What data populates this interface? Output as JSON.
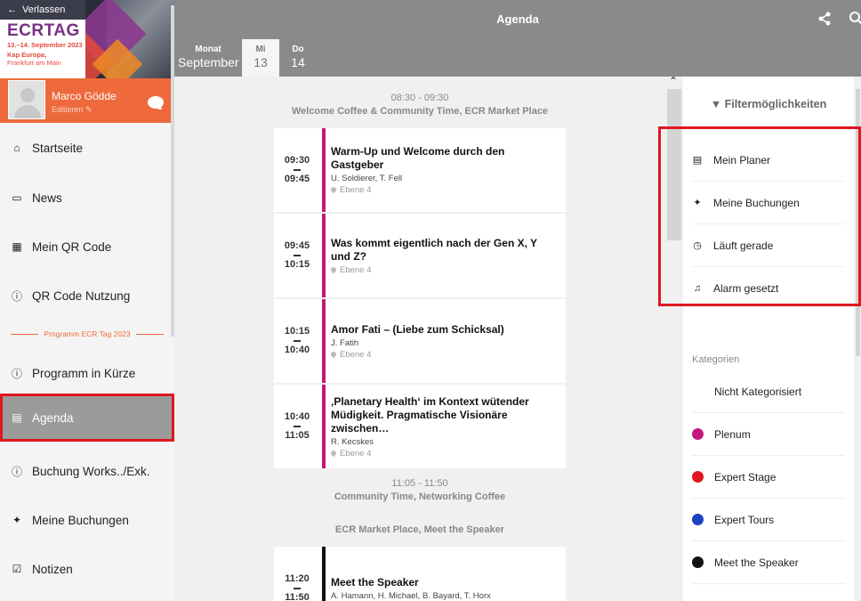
{
  "sidebar": {
    "back_label": "Verlassen",
    "event": {
      "title": "ECRTAG",
      "date": "13.–14. September 2023",
      "place1": "Kap Europa,",
      "place2": "Frankfurt am Main"
    },
    "user": {
      "name": "Marco Gödde",
      "edit": "Editieren"
    },
    "items": [
      {
        "label": "Startseite",
        "icon": "home-icon"
      },
      {
        "label": "News",
        "icon": "inbox-icon"
      },
      {
        "label": "Mein QR Code",
        "icon": "qr-icon"
      },
      {
        "label": "QR Code Nutzung",
        "icon": "info-icon"
      },
      {
        "label": "Programm in Kürze",
        "icon": "info-icon"
      },
      {
        "label": "Agenda",
        "icon": "calendar-icon"
      },
      {
        "label": "Buchung Works../Exk.",
        "icon": "info-icon"
      },
      {
        "label": "Meine Buchungen",
        "icon": "ticket-icon"
      },
      {
        "label": "Notizen",
        "icon": "checklist-icon"
      }
    ],
    "separator": "Programm ECR Tag 2023"
  },
  "header": {
    "title": "Agenda"
  },
  "dates": {
    "month_label": "Monat",
    "month_value": "September",
    "days": [
      {
        "weekday": "Mi",
        "day": "13"
      },
      {
        "weekday": "Do",
        "day": "14"
      }
    ]
  },
  "agenda": {
    "groups": [
      {
        "time": "08:30 - 09:30",
        "title": "Welcome Coffee & Community Time, ECR Market Place"
      },
      {
        "time": "11:05 - 11:50",
        "title": "Community Time, Networking Coffee"
      },
      {
        "time": "",
        "title": "ECR Market Place, Meet the Speaker"
      }
    ],
    "sessions": [
      {
        "start": "09:30",
        "end": "09:45",
        "title": "Warm-Up und Welcome durch den Gastgeber",
        "speakers": "U. Soldierer, T. Fell",
        "room": "Ebene 4"
      },
      {
        "start": "09:45",
        "end": "10:15",
        "title": "Was kommt eigentlich nach der Gen X, Y und Z?",
        "speakers": "",
        "room": "Ebene 4"
      },
      {
        "start": "10:15",
        "end": "10:40",
        "title": "Amor Fati – (Liebe zum Schicksal)",
        "speakers": "J. Fatih",
        "room": "Ebene 4"
      },
      {
        "start": "10:40",
        "end": "11:05",
        "title": "‚Planetary Health‘ im Kontext wütender Müdigkeit. Pragmatische Visionäre zwischen…",
        "speakers": "R. Kecskes",
        "room": "Ebene 4"
      },
      {
        "start": "11:20",
        "end": "11:50",
        "title": "Meet the Speaker",
        "speakers": "A. Hamann, H. Michael, B. Bayard, T. Horx",
        "room": ""
      }
    ]
  },
  "filter": {
    "title": "Filtermöglichkeiten",
    "items": [
      {
        "label": "Mein Planer",
        "icon": "calendar-icon"
      },
      {
        "label": "Meine Buchungen",
        "icon": "ticket-icon"
      },
      {
        "label": "Läuft gerade",
        "icon": "clock-icon"
      },
      {
        "label": "Alarm gesetzt",
        "icon": "bell-icon"
      }
    ],
    "categories_label": "Kategorien",
    "categories": [
      {
        "label": "Nicht Kategorisiert",
        "color": ""
      },
      {
        "label": "Plenum",
        "color": "#c2187a"
      },
      {
        "label": "Expert Stage",
        "color": "#e0161e"
      },
      {
        "label": "Expert Tours",
        "color": "#1f3fc4"
      },
      {
        "label": "Meet the Speaker",
        "color": "#111111"
      }
    ]
  },
  "colors": {
    "accent": "#ee6a3d",
    "header": "#8a8a8a",
    "highlight": "#e0161e",
    "session_bar_plenum": "#c2187a"
  }
}
